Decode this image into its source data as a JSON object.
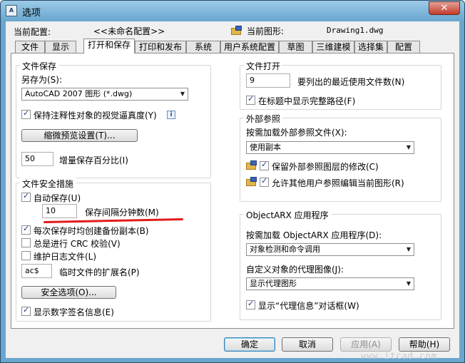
{
  "window": {
    "title": "选项",
    "close_glyph": "✕",
    "app_icon_text": "A"
  },
  "header": {
    "current_profile_label": "当前配置:",
    "current_profile_value": "<<未命名配置>>",
    "current_drawing_label": "当前图形:",
    "current_drawing_value": "Drawing1.dwg"
  },
  "tabs": [
    {
      "label": "文件"
    },
    {
      "label": "显示"
    },
    {
      "label": "打开和保存"
    },
    {
      "label": "打印和发布"
    },
    {
      "label": "系统"
    },
    {
      "label": "用户系统配置"
    },
    {
      "label": "草图"
    },
    {
      "label": "三维建模"
    },
    {
      "label": "选择集"
    },
    {
      "label": "配置"
    }
  ],
  "active_tab": "打开和保存",
  "file_save": {
    "title": "文件保存",
    "save_as_label": "另存为(S):",
    "save_as_value": "AutoCAD 2007 图形 (*.dwg)",
    "annotative_label": "保持注释性对象的视觉逼真度(Y)",
    "annotative_checked": true,
    "thumbnail_button": "缩微预览设置(T)...",
    "incremental_value": "50",
    "incremental_label": "增量保存百分比(I)"
  },
  "file_safety": {
    "title": "文件安全措施",
    "autosave_label": "自动保存(U)",
    "autosave_checked": true,
    "minutes_value": "10",
    "minutes_label": "保存间隔分钟数(M)",
    "backup_label": "每次保存时均创建备份副本(B)",
    "backup_checked": true,
    "crc_label": "总是进行 CRC 校验(V)",
    "crc_checked": false,
    "log_label": "维护日志文件(L)",
    "log_checked": false,
    "temp_ext_value": "ac$",
    "temp_ext_label": "临时文件的扩展名(P)",
    "security_button": "安全选项(O)...",
    "digital_sig_label": "显示数字签名信息(E)",
    "digital_sig_checked": true
  },
  "file_open": {
    "title": "文件打开",
    "recent_count_value": "9",
    "recent_count_label": "要列出的最近使用文件数(N)",
    "full_path_label": "在标题中显示完整路径(F)",
    "full_path_checked": true
  },
  "xref": {
    "title": "外部参照",
    "demand_load_label": "按需加载外部参照文件(X):",
    "demand_load_value": "使用副本",
    "retain_label": "保留外部参照图层的修改(C)",
    "retain_checked": true,
    "allow_edit_label": "允许其他用户参照编辑当前图形(R)",
    "allow_edit_checked": true
  },
  "objectarx": {
    "title": "ObjectARX 应用程序",
    "demand_load_label": "按需加载 ObjectARX 应用程序(D):",
    "demand_load_value": "对象检测和命令调用",
    "proxy_image_label": "自定义对象的代理图像(J):",
    "proxy_image_value": "显示代理图形",
    "proxy_info_label": "显示“代理信息”对话框(W)",
    "proxy_info_checked": true
  },
  "buttons": {
    "ok": "确定",
    "cancel": "取消",
    "apply": "应用(A)",
    "help": "帮助(H)"
  },
  "watermark": "www.itcad.com",
  "check_glyph": "✓",
  "info_glyph": "i",
  "arrow_glyph": "▼",
  "colors": {
    "annotation_underline": "#e11b1b",
    "title_bar": "#6aa7cf"
  }
}
